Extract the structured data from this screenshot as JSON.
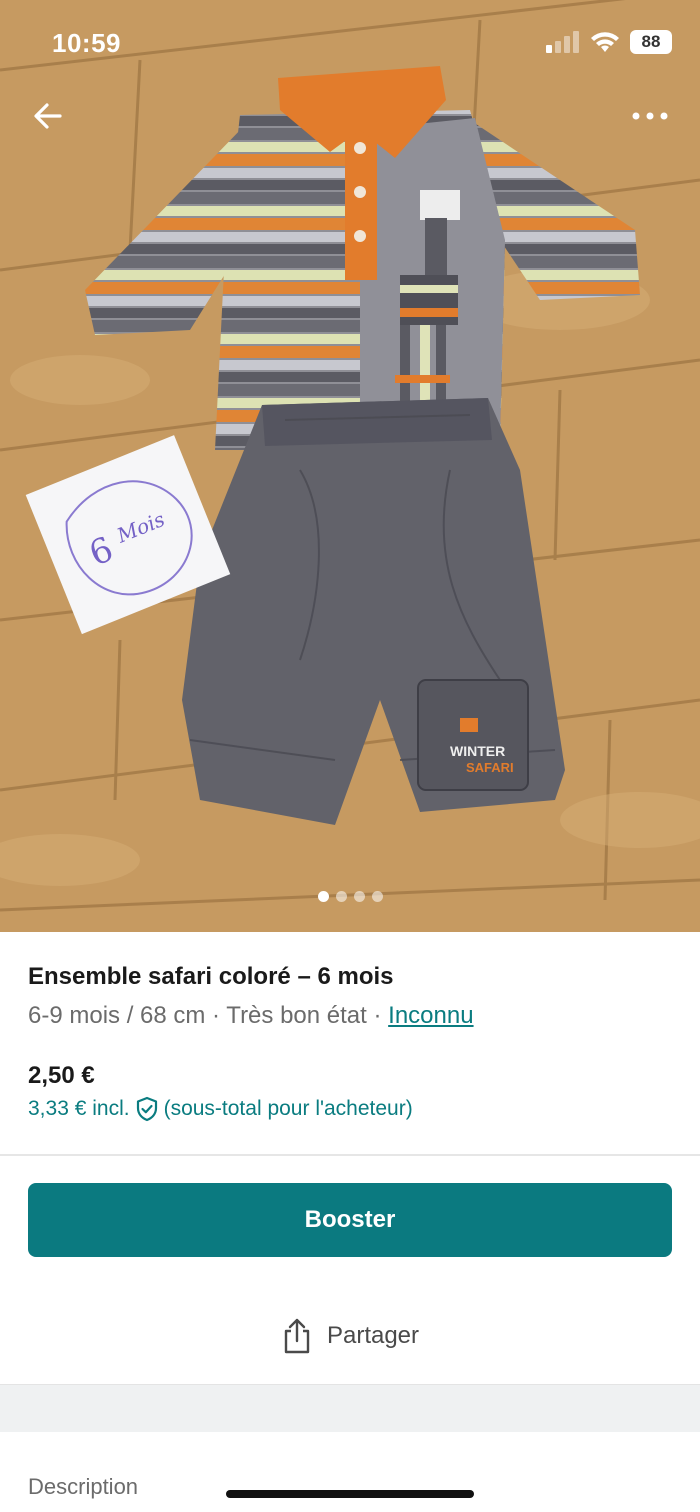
{
  "status_bar": {
    "time": "10:59",
    "battery": "88"
  },
  "photo": {
    "card_text_number": "6",
    "card_text_word": "Mois",
    "pocket_text_1": "WINTER",
    "pocket_text_2": "SAFARI",
    "dots_total": 4,
    "dots_active_index": 0
  },
  "item": {
    "title": "Ensemble safari coloré – 6 mois",
    "size": "6-9 mois / 68 cm",
    "separator": " · ",
    "condition": "Très bon état",
    "brand": "Inconnu",
    "price": "2,50 €",
    "price_incl": "3,33 € incl.",
    "price_incl_note": "(sous-total pour l'acheteur)"
  },
  "actions": {
    "booster_label": "Booster",
    "share_label": "Partager"
  },
  "description_label": "Description",
  "colors": {
    "accent": "#0b7a80",
    "link": "#0a7c80"
  }
}
